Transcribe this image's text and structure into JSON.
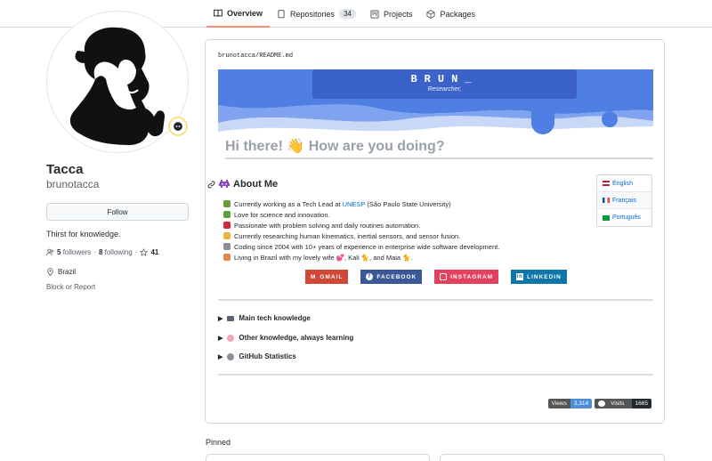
{
  "nav": {
    "tabs": [
      {
        "label": "Overview",
        "icon": "book-icon"
      },
      {
        "label": "Repositories",
        "icon": "repo-icon",
        "count": "34"
      },
      {
        "label": "Projects",
        "icon": "project-icon"
      },
      {
        "label": "Packages",
        "icon": "package-icon"
      }
    ]
  },
  "profile": {
    "name": "Tacca",
    "login": "brunotacca",
    "follow_label": "Follow",
    "bio": "Thirst for knowledge.",
    "followers_count": "5",
    "followers_label": "followers",
    "following_count": "8",
    "following_label": "following",
    "stars_count": "41",
    "location": "Brazil",
    "block_label": "Block or Report"
  },
  "readme": {
    "path_user": "brunotacca",
    "path_sep": "/",
    "path_file": "README.md",
    "banner_title": "BRUN_",
    "banner_sub": "Researcher,",
    "greeting": "Hi there! 👋 How are you doing?",
    "about_title": "About Me",
    "languages": [
      {
        "label": "English"
      },
      {
        "label": "Français"
      },
      {
        "label": "Português"
      }
    ],
    "about_items": [
      {
        "text": "Currently working as a Tech Lead at ",
        "link": "UNESP",
        "after": " (São Paulo State University)",
        "color": "#6a9b3a"
      },
      {
        "text": "Love for science and innovation.",
        "link": "",
        "after": "",
        "color": "#5aa33b"
      },
      {
        "text": "Passionate with problem solving and daily routines automation.",
        "link": "",
        "after": "",
        "color": "#d7263d"
      },
      {
        "text": "Currently researching human kinematics, inertial sensors, and sensor fusion.",
        "link": "",
        "after": "",
        "color": "#f2b33d"
      },
      {
        "text": "Coding since 2004 with 10+ years of experience in enterprise wide software development.",
        "link": "",
        "after": "",
        "color": "#8a8f98"
      },
      {
        "text": "Living in Brazil with my lovely wife 💕, Kali 🐈, and Maia 🐈.",
        "link": "",
        "after": "",
        "color": "#e3864b"
      }
    ],
    "socials": [
      {
        "label": "GMAIL",
        "color": "#d14836"
      },
      {
        "label": "FACEBOOK",
        "color": "#3b5998"
      },
      {
        "label": "INSTAGRAM",
        "color": "#e4405f"
      },
      {
        "label": "LINKEDIN",
        "color": "#0e76a8"
      }
    ],
    "sections": [
      {
        "label": "Main tech knowledge"
      },
      {
        "label": "Other knowledge, always learning"
      },
      {
        "label": "GitHub Statistics"
      }
    ],
    "badge_views_label": "Views",
    "badge_views_value": "3,314",
    "badge_visits_label": "Visits",
    "badge_visits_value": "1665"
  },
  "pinned_label": "Pinned",
  "colors": {
    "accent": "#fd8c73",
    "link": "#0969da",
    "banner_blue": "#3a62c7",
    "wave_blue": "#4f7fe3"
  }
}
